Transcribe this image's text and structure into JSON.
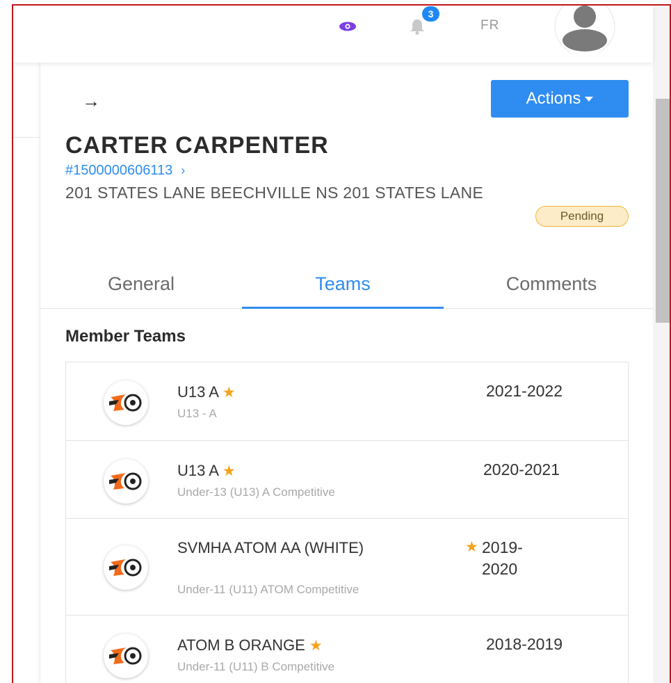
{
  "header": {
    "notifications_count": "3",
    "language": "FR",
    "icons": [
      "eye-icon",
      "bell-icon",
      "avatar-icon"
    ]
  },
  "actions_button": {
    "label": "Actions"
  },
  "member": {
    "name": "CARTER CARPENTER",
    "id": "#1500000606113",
    "address": "201 STATES LANE BEECHVILLE NS 201 STATES LANE",
    "status": "Pending"
  },
  "tabs": [
    {
      "label": "General"
    },
    {
      "label": "Teams"
    },
    {
      "label": "Comments"
    }
  ],
  "section": {
    "title": "Member Teams"
  },
  "teams": [
    {
      "name": "U13 A",
      "desc": "U13 - A",
      "season": "2021-2022"
    },
    {
      "name": "U13 A",
      "desc": "Under-13 (U13) A Competitive",
      "season": "2020-2021"
    },
    {
      "name": "SVMHA ATOM AA (WHITE)",
      "desc": "Under-11 (U11) ATOM Competitive",
      "season": "2019-2020"
    },
    {
      "name": "ATOM B ORANGE",
      "desc": "Under-11 (U11) B Competitive",
      "season": "2018-2019"
    }
  ],
  "colors": {
    "accent": "#2f8cf0",
    "star": "#f4a21b",
    "pending_bg": "#fdecc8",
    "pending_border": "#f2b535"
  }
}
